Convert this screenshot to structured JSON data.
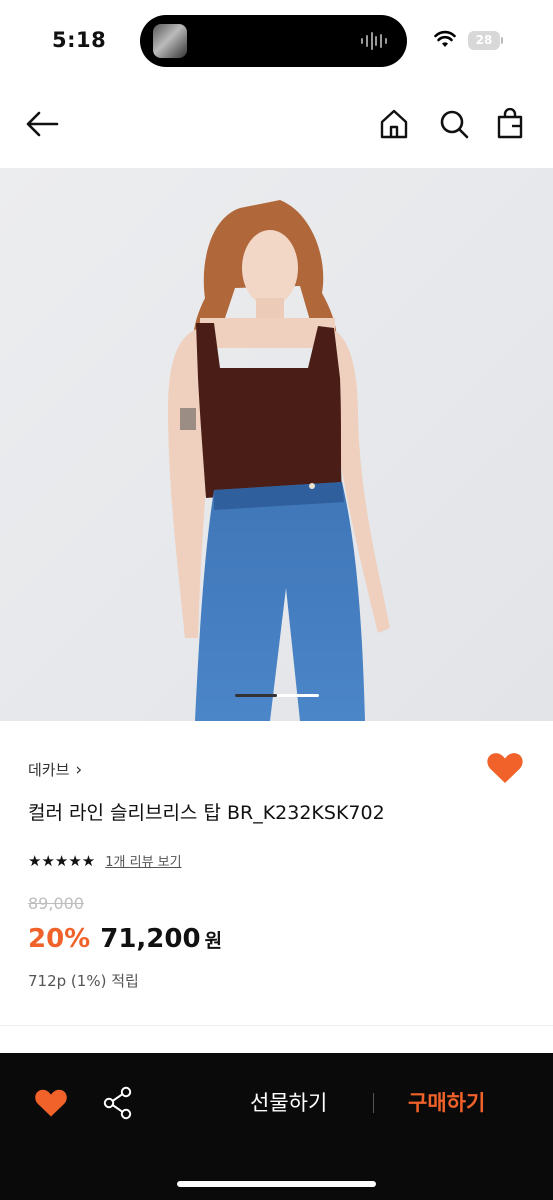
{
  "status_bar": {
    "time": "5:18",
    "battery": "28"
  },
  "nav": {
    "back_icon": "arrow-left-icon",
    "home_icon": "home-icon",
    "search_icon": "search-icon",
    "bag_icon": "shopping-bag-icon"
  },
  "gallery": {
    "image_description_icon": "product-photo",
    "current_index": 1,
    "total": 2
  },
  "product": {
    "brand": "데카브",
    "brand_chevron": "›",
    "name": "컬러 라인 슬리브리스 탑 BR_K232KSK702",
    "stars": "★★★★★",
    "review_link": "1개 리뷰 보기",
    "original_price": "89,000",
    "discount": "20%",
    "price": "71,200",
    "currency": "원",
    "points": "712p (1%) 적립",
    "wishlisted": true
  },
  "bottom_bar": {
    "gift_label": "선물하기",
    "buy_label": "구매하기"
  },
  "colors": {
    "accent": "#f0622a",
    "bottom_bar_bg": "#0a0a0a"
  }
}
